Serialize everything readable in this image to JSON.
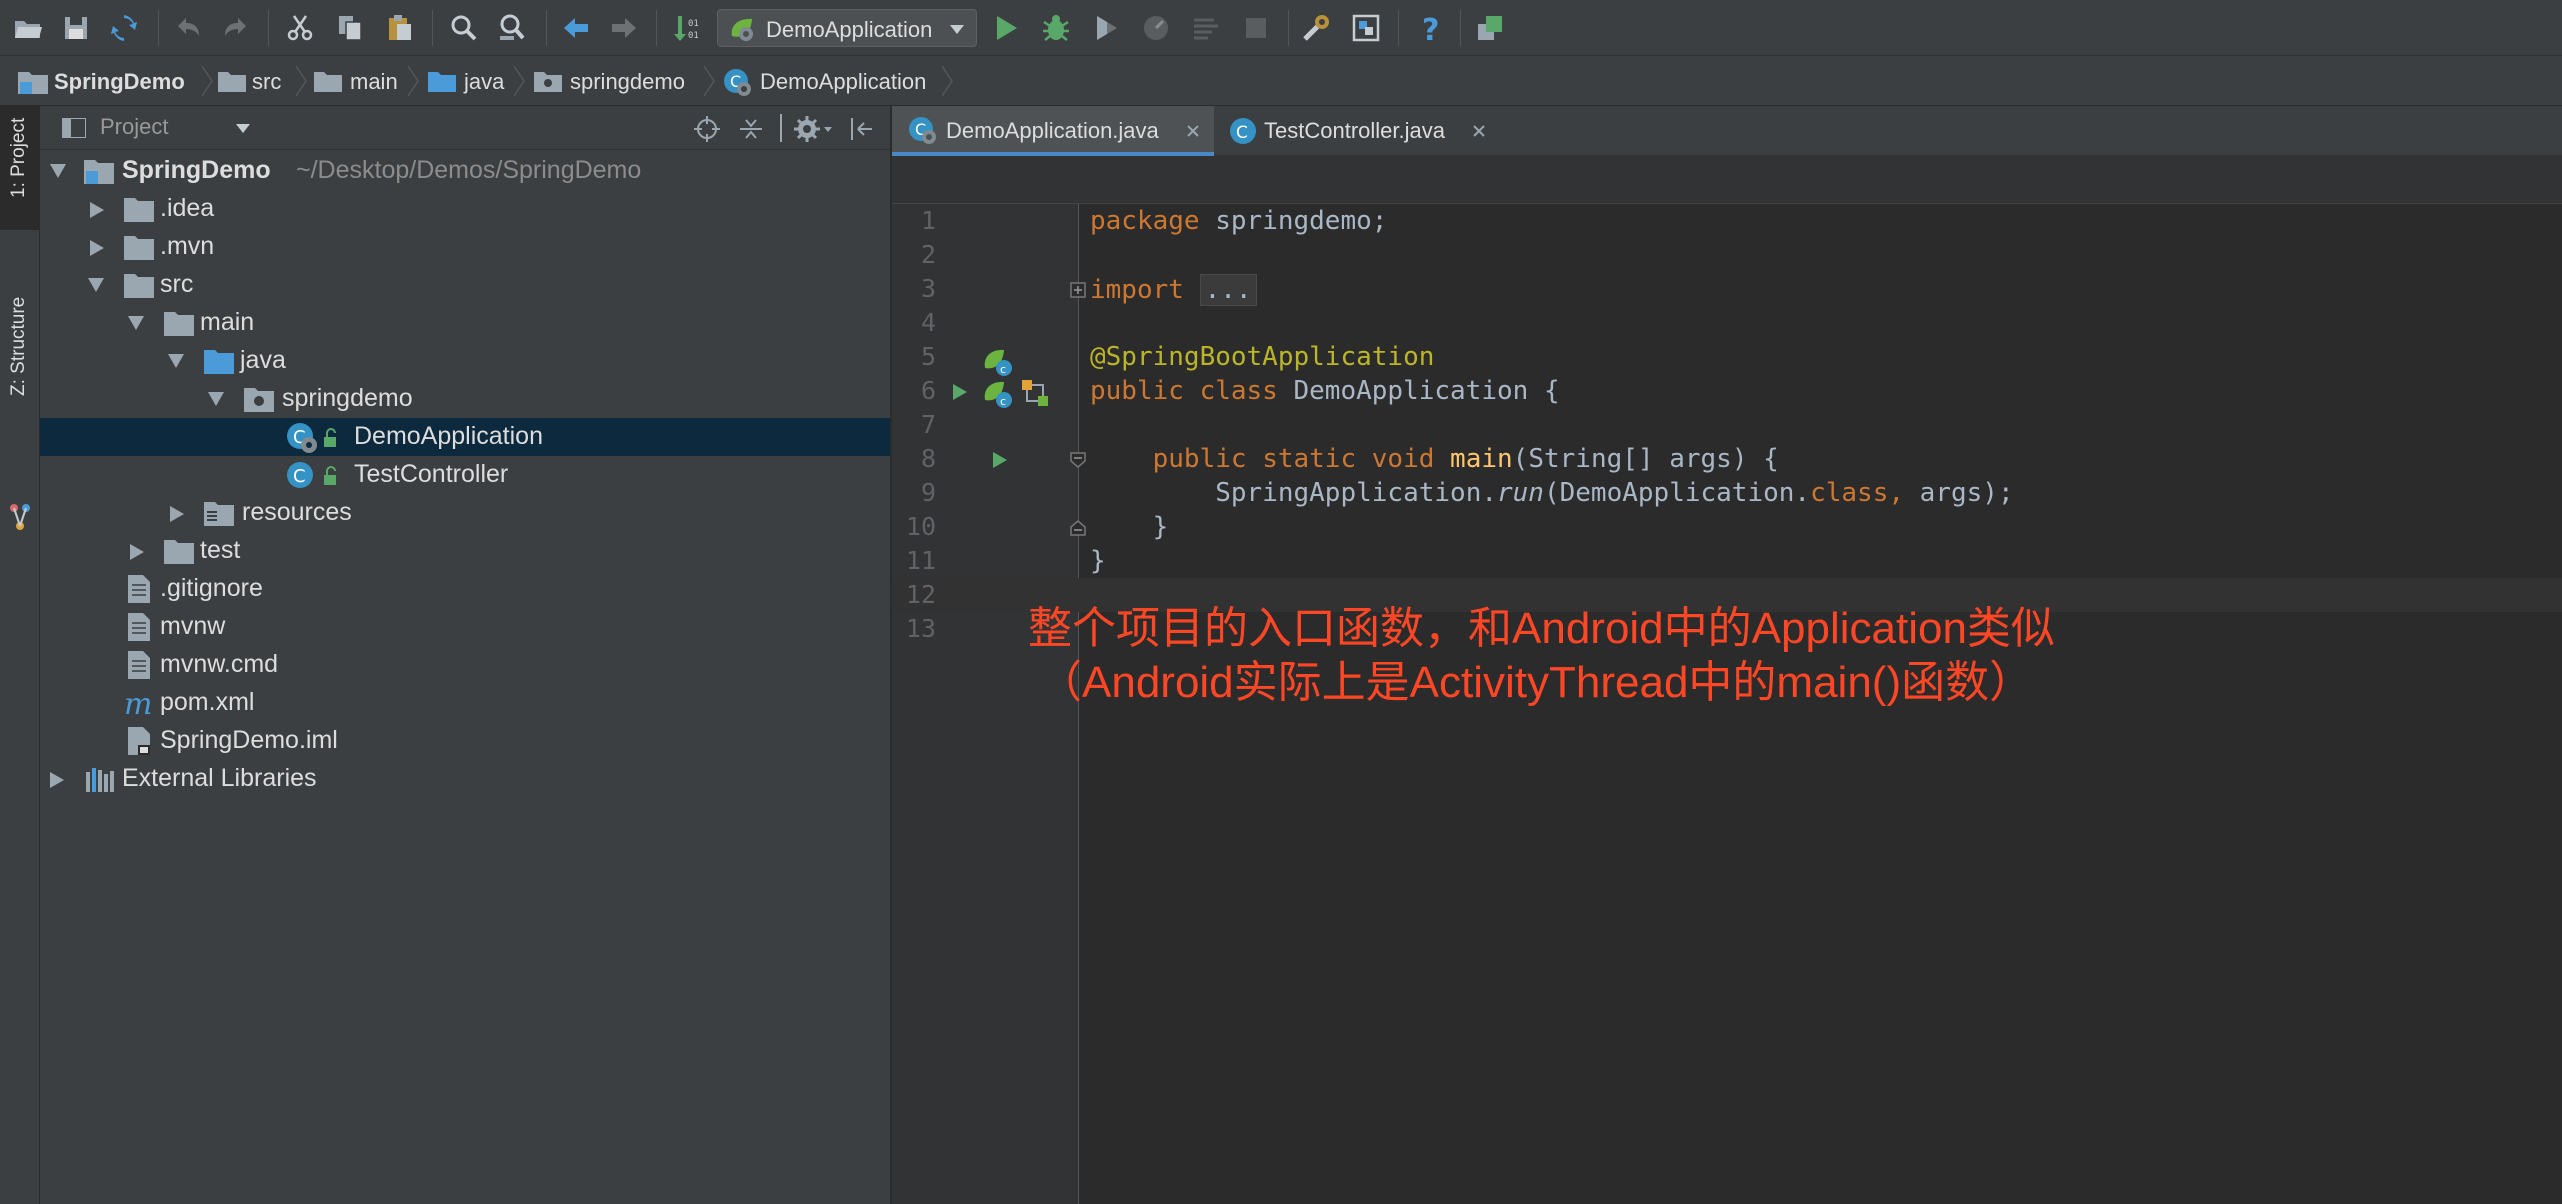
{
  "toolbar": {
    "run_config": "DemoApplication",
    "icons": [
      "open-folder",
      "save",
      "synchronize",
      "undo",
      "redo",
      "cut",
      "copy",
      "paste",
      "find",
      "find-usages",
      "back",
      "forward",
      "build",
      "run",
      "debug",
      "coverage",
      "profile",
      "run-tasks",
      "stop",
      "settings",
      "project-structure",
      "help",
      "vcs-commit"
    ]
  },
  "navbar": {
    "crumbs": [
      "SpringDemo",
      "src",
      "main",
      "java",
      "springdemo",
      "DemoApplication"
    ]
  },
  "toolstrip": {
    "project_tab": "1: Project",
    "structure_tab": "Z: Structure"
  },
  "project_panel": {
    "title": "Project",
    "tree": {
      "root_label": "SpringDemo",
      "root_path": "~/Desktop/Demos/SpringDemo",
      "idea": ".idea",
      "mvn": ".mvn",
      "src": "src",
      "main": "main",
      "java": "java",
      "springdemo": "springdemo",
      "demo_application": "DemoApplication",
      "test_controller": "TestController",
      "resources": "resources",
      "test": "test",
      "gitignore": ".gitignore",
      "mvnw": "mvnw",
      "mvnw_cmd": "mvnw.cmd",
      "pom": "pom.xml",
      "iml": "SpringDemo.iml",
      "external_libraries": "External Libraries"
    }
  },
  "editor": {
    "tabs": [
      "DemoApplication.java",
      "TestController.java"
    ],
    "line_numbers": [
      "1",
      "2",
      "3",
      "4",
      "5",
      "6",
      "7",
      "8",
      "9",
      "10",
      "11",
      "12",
      "13"
    ],
    "code": {
      "l1_kw": "package",
      "l1_rest": " springdemo;",
      "l3_kw": "import",
      "l3_fold": "...",
      "l6_ann": "@SpringBootApplication",
      "l7_kw": "public class",
      "l7_rest": " DemoApplication {",
      "l9_indent": "    ",
      "l9_kw": "public static void",
      "l9_fn": "main",
      "l9_rest": "(String[] args) {",
      "l10_indent": "        ",
      "l10_cls": "SpringApplication.",
      "l10_method": "run",
      "l10_mid": "(DemoApplication.",
      "l10_kw": "class",
      "l10_comma": ", ",
      "l10_args": "args);",
      "l11": "    }",
      "l12": "}"
    }
  },
  "annotation": {
    "line1": "整个项目的入口函数，和Android中的Application类似",
    "line2": "（Android实际上是ActivityThread中的main()函数）"
  },
  "colors": {
    "keyword": "#cc7832",
    "annotation": "#bbb529",
    "method": "#ffc66d",
    "text": "#a9b7c6",
    "note": "#ff4726",
    "selection": "#0d293e"
  }
}
